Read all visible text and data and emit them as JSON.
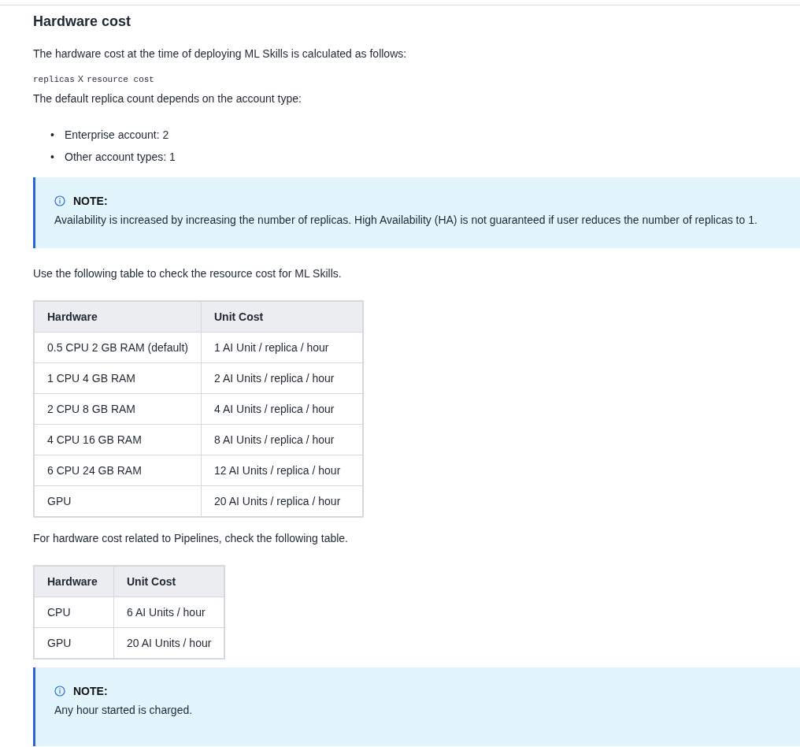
{
  "heading": "Hardware cost",
  "intro": "The hardware cost at the time of deploying ML Skills is calculated as follows:",
  "formula": [
    {
      "kind": "code",
      "text": "replicas"
    },
    {
      "kind": "text",
      "text": "X"
    },
    {
      "kind": "code",
      "text": "resource cost"
    }
  ],
  "default_text": "The default replica count depends on the account type:",
  "bullets": [
    {
      "marker": "•",
      "text": "Enterprise account: 2"
    },
    {
      "marker": "•",
      "text": "Other account types: 1"
    }
  ],
  "note_1": {
    "title": "NOTE:",
    "text": "Availability is increased by increasing the number of replicas. High Availability (HA) is not guaranteed if user reduces the number of replicas to 1."
  },
  "table_intro": "Use the following table to check the resource cost for ML Skills.",
  "table_1": {
    "columns": [
      "Hardware",
      "Unit Cost"
    ],
    "rows": [
      [
        "0.5 CPU 2 GB RAM (default)",
        "1 AI Unit / replica / hour"
      ],
      [
        "1 CPU 4 GB RAM",
        "2 AI Units / replica / hour"
      ],
      [
        "2 CPU 8 GB RAM",
        "4 AI Units / replica / hour"
      ],
      [
        "4 CPU 16 GB RAM",
        "8 AI Units / replica / hour"
      ],
      [
        "6 CPU 24 GB RAM",
        "12 AI Units / replica / hour"
      ],
      [
        "GPU",
        "20 AI Units / replica / hour"
      ]
    ]
  },
  "pipelines_intro": "For hardware cost related to Pipelines, check the following table.",
  "table_2": {
    "columns": [
      "Hardware",
      "Unit Cost"
    ],
    "rows": [
      [
        "CPU",
        "6 AI Units / hour"
      ],
      [
        "GPU",
        "20 AI Units / hour"
      ]
    ]
  },
  "note_2": {
    "title": "NOTE:",
    "text": "Any hour started is charged."
  }
}
